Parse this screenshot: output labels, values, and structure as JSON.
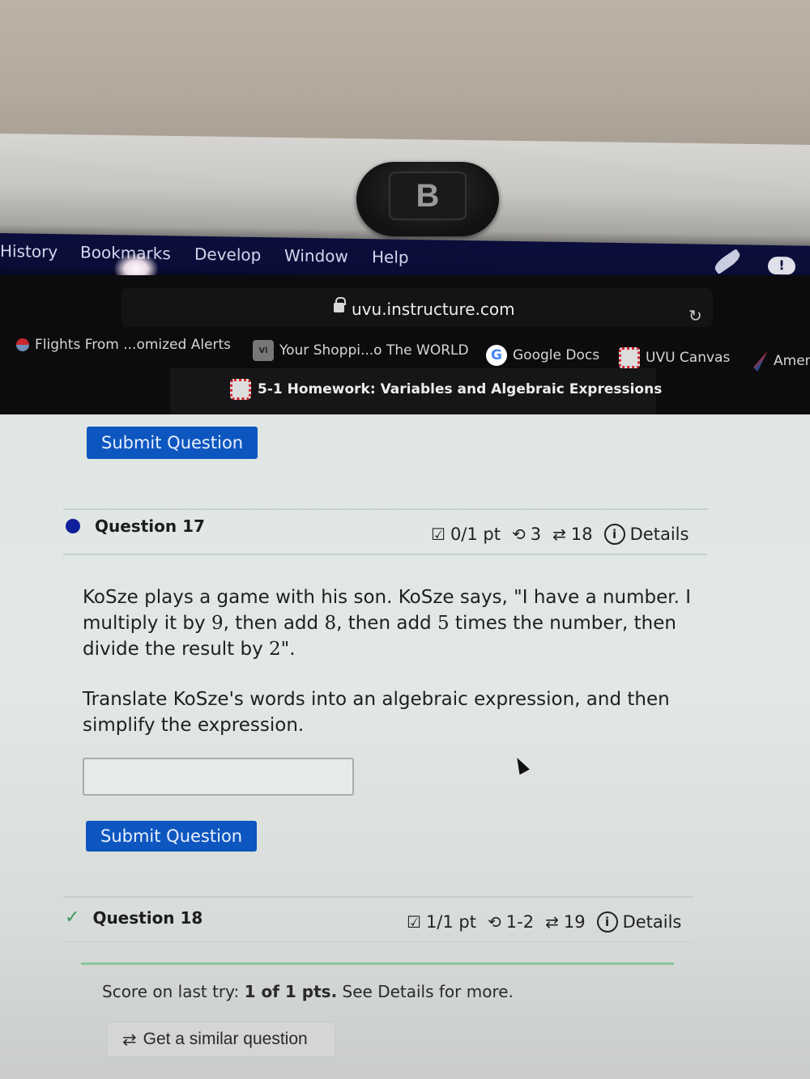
{
  "menubar": {
    "items": [
      "History",
      "Bookmarks",
      "Develop",
      "Window",
      "Help"
    ],
    "icons": [
      "quill-icon",
      "cloud-alert-icon"
    ]
  },
  "browser": {
    "url": "uvu.instructure.com",
    "bookmarks": [
      {
        "label": "Flights From ...omized Alerts",
        "icon": "flight-icon"
      },
      {
        "label": "Your Shoppi...o The WORLD",
        "icon": "shopping-icon"
      },
      {
        "label": "Google Docs",
        "icon": "google-icon"
      },
      {
        "label": "UVU Canvas",
        "icon": "canvas-icon"
      },
      {
        "label": "Amer",
        "icon": "airline-icon"
      }
    ],
    "tab_title": "5-1 Homework: Variables and Algebraic Expressions"
  },
  "page": {
    "top_submit_label": "Submit Question",
    "question17": {
      "title": "Question 17",
      "points": "0/1 pt",
      "attempts": "3",
      "versions": "18",
      "details_label": "Details",
      "paragraph1_parts": {
        "a": "KoSze plays a game with his son. KoSze says, \"I have a number. I",
        "b1": "multiply it by ",
        "n1": "9",
        "b2": ", then add ",
        "n2": "8",
        "b3": ", then add ",
        "n3": "5",
        "b4": " times the number, then",
        "c1": "divide the result by ",
        "n4": "2",
        "c2": "\"."
      },
      "paragraph2_line1": "Translate KoSze's words into an algebraic expression, and then",
      "paragraph2_line2": "simplify the expression.",
      "answer_value": "",
      "submit_label": "Submit Question"
    },
    "question18": {
      "title": "Question 18",
      "points": "1/1 pt",
      "attempts": "1-2",
      "versions": "19",
      "details_label": "Details",
      "score_prefix": "Score on last try: ",
      "score_bold": "1 of 1 pts.",
      "score_suffix": " See Details for more.",
      "similar_label": "Get a similar question"
    }
  },
  "colors": {
    "submit_button": "#0e56bf",
    "current_question_dot": "#10209a",
    "correct_check": "#3f9a5c",
    "menubar_bg": "#0b0e3a"
  }
}
